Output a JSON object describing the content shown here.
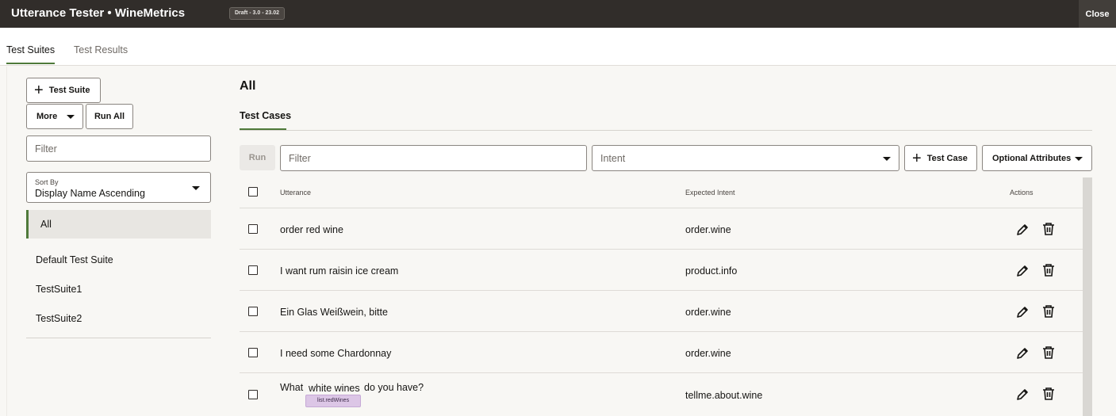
{
  "header": {
    "title": "Utterance Tester • WineMetrics",
    "badge": "Draft - 3.0 - 23.02",
    "close_label": "Close"
  },
  "tabs": [
    {
      "label": "Test Suites",
      "active": true
    },
    {
      "label": "Test Results",
      "active": false
    }
  ],
  "sidebar": {
    "add_suite_label": "Test Suite",
    "more_label": "More",
    "run_all_label": "Run All",
    "filter_placeholder": "Filter",
    "sort_caption": "Sort By",
    "sort_value": "Display Name Ascending",
    "suites": [
      {
        "label": "All",
        "selected": true
      },
      {
        "label": "Default Test Suite",
        "selected": false
      },
      {
        "label": "TestSuite1",
        "selected": false
      },
      {
        "label": "TestSuite2",
        "selected": false
      }
    ]
  },
  "main": {
    "heading": "All",
    "subtab": "Test Cases",
    "run_label": "Run",
    "filter_placeholder": "Filter",
    "intent_placeholder": "Intent",
    "add_case_label": "Test Case",
    "optional_label": "Optional Attributes",
    "columns": {
      "utterance": "Utterance",
      "expected_intent": "Expected Intent",
      "actions": "Actions"
    },
    "rows": [
      {
        "utterance": "order red wine",
        "intent": "order.wine"
      },
      {
        "utterance": "I want rum raisin ice cream",
        "intent": "product.info"
      },
      {
        "utterance": "Ein Glas Weißwein, bitte",
        "intent": "order.wine"
      },
      {
        "utterance": "I need some Chardonnay",
        "intent": "order.wine"
      }
    ],
    "entity_row": {
      "before": "What",
      "entity_text": "white wines",
      "after": "do you have?",
      "entity_tag": "list.redWines",
      "intent": "tellme.about.wine"
    }
  },
  "colors": {
    "accent": "#4f7a3a",
    "topbar": "#312d2a",
    "entity_tag": "#dcc6e6"
  },
  "icons": [
    "plus-icon",
    "caret-down-icon",
    "edit-icon",
    "delete-icon"
  ]
}
